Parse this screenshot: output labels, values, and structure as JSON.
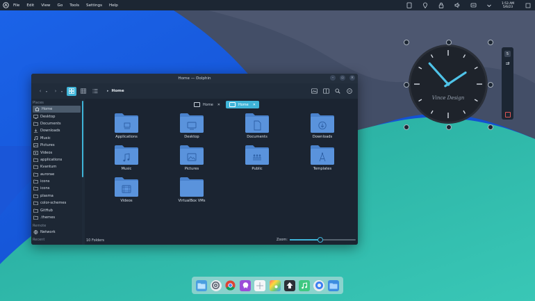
{
  "menubar": {
    "items": [
      "File",
      "Edit",
      "View",
      "Go",
      "Tools",
      "Settings",
      "Help"
    ],
    "clock_time": "1:53 AM",
    "clock_date": "5/6/23"
  },
  "window": {
    "title": "Home — Dolphin",
    "breadcrumb": "Home",
    "tabs": [
      {
        "label": "Home",
        "active": false
      },
      {
        "label": "Home",
        "active": true
      }
    ],
    "status_text": "10 Folders",
    "zoom_label": "Zoom:",
    "zoom_level": 0.45
  },
  "sidebar": {
    "places_header": "Places",
    "places": [
      "Home",
      "Desktop",
      "Documents",
      "Downloads",
      "Music",
      "Pictures",
      "Videos",
      "applications",
      "Kvantum",
      "aurorae",
      "icons",
      "icons",
      "plasma",
      "color-schemes",
      "GitHub",
      ".themes"
    ],
    "remote_header": "Remote",
    "remote": [
      "Network"
    ],
    "recent_header": "Recent"
  },
  "folders": [
    {
      "label": "Applications",
      "glyph": "applications-icon"
    },
    {
      "label": "Desktop",
      "glyph": "desktop-icon"
    },
    {
      "label": "Documents",
      "glyph": "document-icon"
    },
    {
      "label": "Downloads",
      "glyph": "download-icon"
    },
    {
      "label": "Music",
      "glyph": "music-icon"
    },
    {
      "label": "Pictures",
      "glyph": "picture-icon"
    },
    {
      "label": "Public",
      "glyph": "public-icon"
    },
    {
      "label": "Templates",
      "glyph": "templates-icon"
    },
    {
      "label": "Videos",
      "glyph": "video-icon"
    },
    {
      "label": "VirtualBox VMs",
      "glyph": "none"
    }
  ],
  "clock_widget": {
    "brand": "Vince Design",
    "hour": 1,
    "minute": 53
  },
  "side_panel": {
    "badge": "5"
  },
  "dock": {
    "apps": [
      "files-icon",
      "settings-icon",
      "chrome-icon",
      "github-icon",
      "screenshot-icon",
      "color-picker-icon",
      "inkscape-icon",
      "music-icon",
      "browser-icon",
      "folder-icon"
    ]
  },
  "colors": {
    "accent": "#3fb4d8",
    "folder": "#5a93dc",
    "window_bg": "#1f2a38"
  }
}
